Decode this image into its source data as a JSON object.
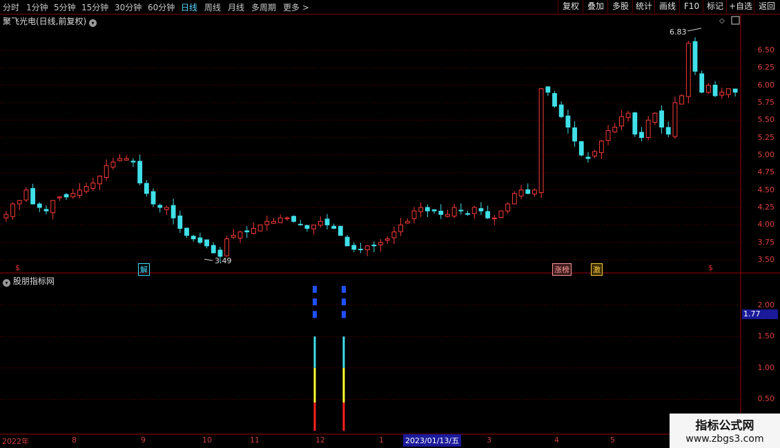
{
  "toolbar": {
    "periods": [
      "分时",
      "1分钟",
      "5分钟",
      "15分钟",
      "30分钟",
      "60分钟",
      "日线",
      "周线",
      "月线",
      "多周期",
      "更多 >"
    ],
    "active_period": "日线",
    "right_buttons": [
      "复权",
      "叠加",
      "多股",
      "统计",
      "画线",
      "F10",
      "标记",
      "+自选",
      "返回"
    ]
  },
  "chart_title": "聚飞光电(日线,前复权)",
  "indicator_title": "股朋指标网",
  "annotations": {
    "high_label": "6.83",
    "low_label": "3.49"
  },
  "event_markers": [
    {
      "text": "$",
      "color": "#e03030"
    },
    {
      "text": "解",
      "color": "#40e0ff"
    },
    {
      "text": "涨榜",
      "color": "#ff9a9a"
    },
    {
      "text": "激",
      "color": "#ffd040"
    },
    {
      "text": "$",
      "color": "#e03030"
    }
  ],
  "price_axis": [
    "6.50",
    "6.25",
    "6.00",
    "5.75",
    "5.50",
    "5.25",
    "5.00",
    "4.75",
    "4.50",
    "4.25",
    "4.00",
    "3.75",
    "3.50"
  ],
  "indicator_axis": [
    "2.00",
    "1.50",
    "1.00",
    "0.50"
  ],
  "indicator_current": "1.77",
  "date_axis": [
    "2022年",
    "8",
    "9",
    "10",
    "11",
    "12",
    "1",
    "2023/01/13/五",
    "3",
    "4",
    "5"
  ],
  "watermark": {
    "line1": "指标公式网",
    "line2": "www.zbgs3.com"
  },
  "colors": {
    "up": "#ff3a3a",
    "down": "#40e0e8",
    "grid": "#7a0000",
    "signal_cyan": "#40e0e8",
    "signal_yellow": "#ffff30",
    "signal_red": "#ff2020",
    "signal_blue": "#2050ff"
  },
  "chart_data": {
    "type": "candlestick",
    "title": "聚飞光电(日线,前复权)",
    "price_range": [
      3.4,
      6.9
    ],
    "close_series": [
      4.15,
      4.3,
      4.35,
      4.5,
      4.3,
      4.25,
      4.2,
      4.35,
      4.4,
      4.4,
      4.45,
      4.5,
      4.55,
      4.6,
      4.7,
      4.85,
      4.9,
      4.95,
      4.95,
      4.9,
      4.6,
      4.45,
      4.3,
      4.25,
      4.25,
      4.1,
      3.95,
      3.85,
      3.8,
      3.75,
      3.7,
      3.6,
      3.55,
      3.8,
      3.85,
      3.9,
      3.9,
      3.95,
      4.0,
      4.05,
      4.05,
      4.1,
      4.1,
      4.05,
      4.0,
      3.95,
      4.0,
      4.05,
      4.0,
      3.95,
      3.85,
      3.7,
      3.65,
      3.65,
      3.7,
      3.7,
      3.75,
      3.8,
      3.9,
      4.0,
      4.05,
      4.2,
      4.25,
      4.2,
      4.2,
      4.15,
      4.15,
      4.25,
      4.2,
      4.15,
      4.25,
      4.2,
      4.1,
      4.1,
      4.2,
      4.3,
      4.45,
      4.5,
      4.45,
      4.5,
      5.95,
      5.9,
      5.7,
      5.55,
      5.4,
      5.2,
      5.0,
      4.95,
      5.05,
      5.2,
      5.35,
      5.4,
      5.55,
      5.6,
      5.3,
      5.25,
      5.5,
      5.6,
      5.4,
      5.3,
      5.75,
      5.85,
      6.6,
      6.2,
      5.9,
      6.0,
      5.85,
      5.9,
      5.95,
      5.9
    ],
    "indicator_signals": [
      {
        "date_index": "bar near 12",
        "segments": [
          {
            "color": "red",
            "from": 0.0,
            "to": 0.45
          },
          {
            "color": "yellow",
            "from": 0.45,
            "to": 1.0
          },
          {
            "color": "cyan",
            "from": 1.0,
            "to": 1.5
          }
        ],
        "dots": [
          1.85,
          2.05,
          2.25
        ]
      },
      {
        "date_index": "bar after 12",
        "segments": [
          {
            "color": "red",
            "from": 0.0,
            "to": 0.45
          },
          {
            "color": "yellow",
            "from": 0.45,
            "to": 1.0
          },
          {
            "color": "cyan",
            "from": 1.0,
            "to": 1.5
          }
        ],
        "dots": [
          1.85,
          2.05,
          2.25
        ]
      }
    ],
    "indicator_range": [
      0.0,
      2.5
    ]
  }
}
